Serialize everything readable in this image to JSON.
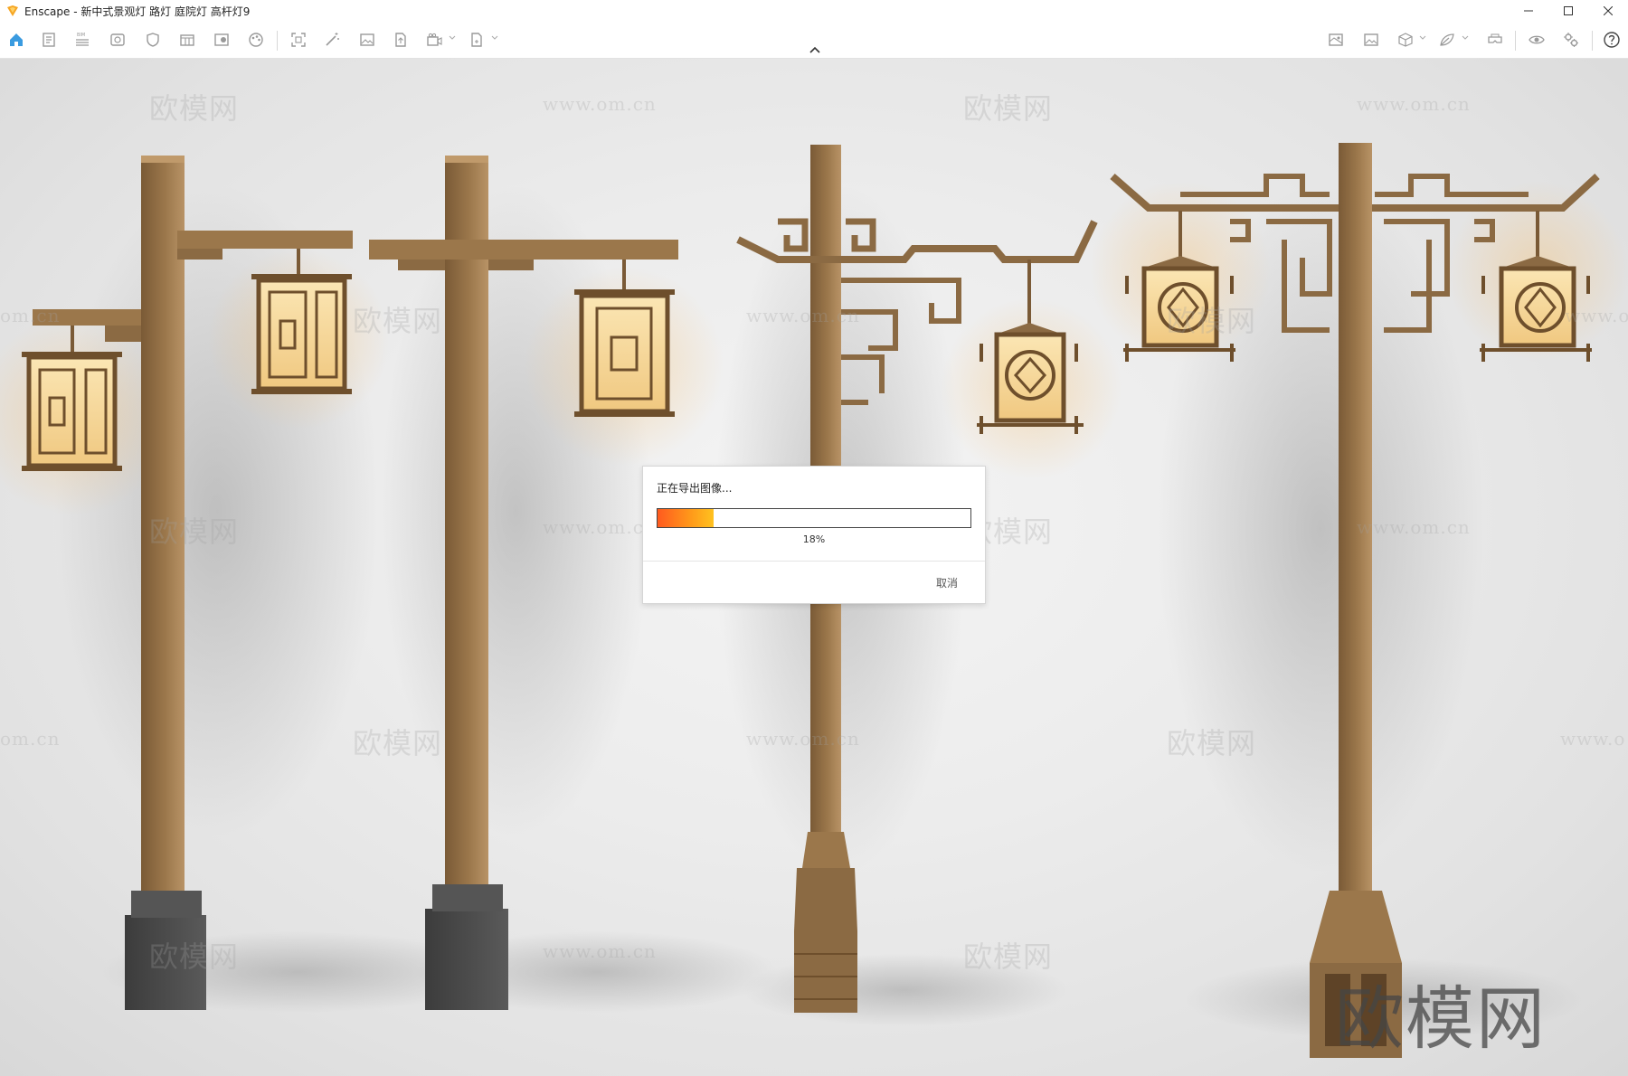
{
  "window": {
    "app_name": "Enscape",
    "title": "Enscape - 新中式景观灯 路灯 庭院灯 高杆灯9",
    "controls": [
      "minimize",
      "maximize",
      "close"
    ]
  },
  "toolbar": {
    "left_icons": [
      "home-icon",
      "document-icon",
      "bim-list-icon",
      "view-icon",
      "shield-icon",
      "library-icon",
      "info-book-icon",
      "palette-icon",
      "capture-icon",
      "magic-wand-icon",
      "image-icon",
      "upload-icon",
      "video-icon",
      "export-icon"
    ],
    "right_icons": [
      "map-icon",
      "gallery-icon",
      "cube-icon",
      "leaf-icon",
      "vr-headset-icon",
      "eye-icon",
      "settings-icon",
      "help-icon"
    ]
  },
  "dialog": {
    "message": "正在导出图像...",
    "progress_percent": 18,
    "progress_label": "18%",
    "cancel_label": "取消"
  },
  "watermarks": {
    "brand": "欧模网",
    "url": "www.om.cn",
    "fragment_left": "om.cn",
    "fragment_right": "www.o"
  },
  "colors": {
    "pole": "#8b6a43",
    "pole_light": "#a8845a",
    "lantern_glow": "#f6dfa6",
    "base_stone": "#4a4a4a",
    "progress_start": "#ff5a1f",
    "progress_end": "#ffc21f"
  }
}
